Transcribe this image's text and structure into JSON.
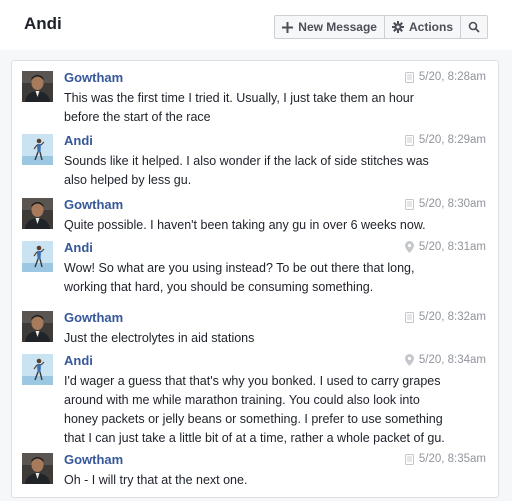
{
  "header": {
    "title": "Andi",
    "new_message_label": "New Message",
    "actions_label": "Actions"
  },
  "colors": {
    "sender_link": "#365899",
    "timestamp": "#90949c"
  },
  "messages": [
    {
      "sender": "Gowtham",
      "time": "5/20, 8:28am",
      "source_icon": "mobile-icon",
      "lines": [
        "This was the first time I tried it. Usually, I just take them an hour",
        "before the start of the race"
      ]
    },
    {
      "sender": "Andi",
      "time": "5/20, 8:29am",
      "source_icon": "mobile-icon",
      "lines": [
        "Sounds like it helped. I also wonder if the lack of side stitches was",
        "also helped by less gu."
      ]
    },
    {
      "sender": "Gowtham",
      "time": "5/20, 8:30am",
      "source_icon": "mobile-icon",
      "lines": [
        "Quite possible. I haven't been taking any gu in over 6 weeks now."
      ]
    },
    {
      "sender": "Andi",
      "time": "5/20, 8:31am",
      "source_icon": "location-pin-icon",
      "lines": [
        "Wow!  So what are you using instead?  To be out there that long,",
        "working that hard, you should be consuming something."
      ]
    },
    {
      "sender": "Gowtham",
      "time": "5/20, 8:32am",
      "source_icon": "mobile-icon",
      "lines": [
        "Just the electrolytes in aid stations"
      ]
    },
    {
      "sender": "Andi",
      "time": "5/20, 8:34am",
      "source_icon": "location-pin-icon",
      "lines": [
        "I'd wager a guess that that's why you bonked. I used to carry grapes",
        "around with me while marathon training. You could also look into",
        "honey packets or jelly beans or something. I prefer to use something",
        "that I can just take a little bit of at a time, rather a whole packet of gu."
      ]
    },
    {
      "sender": "Gowtham",
      "time": "5/20, 8:35am",
      "source_icon": "mobile-icon",
      "lines": [
        "Oh - I will try that at the next one."
      ]
    }
  ]
}
